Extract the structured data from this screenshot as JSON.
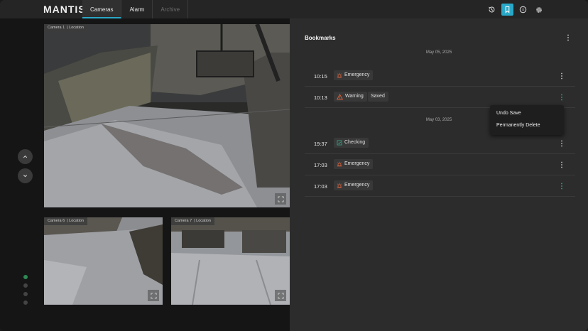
{
  "app": {
    "logo": "MANTIS"
  },
  "tabs": [
    {
      "label": "Cameras",
      "state": "active"
    },
    {
      "label": "Alarm",
      "state": "normal"
    },
    {
      "label": "Archive",
      "state": "disabled"
    }
  ],
  "toolbar": {
    "icons": [
      "history-icon",
      "bookmark-icon",
      "info-icon",
      "settings-icon"
    ],
    "active_icon": "bookmark-icon",
    "accent_color": "#2aa8c8"
  },
  "cameras": {
    "main": {
      "label": "Camera 1",
      "sublabel": "Location"
    },
    "tile_left": {
      "label": "Camera 6",
      "sublabel": "Location"
    },
    "tile_right": {
      "label": "Camera 7",
      "sublabel": "Location"
    }
  },
  "pager": {
    "pages": 4,
    "active_page": 1,
    "active_color": "#2e8a55"
  },
  "bookmarks": {
    "title": "Bookmarks",
    "groups": [
      {
        "date": "May 05, 2025",
        "items": [
          {
            "time": "10:15",
            "tag": "Emergency",
            "tag_icon": "emergency-icon",
            "tag_color": "#e0643c",
            "extra": ""
          },
          {
            "time": "10:13",
            "tag": "Warning",
            "tag_icon": "warning-icon",
            "tag_color": "#e0643c",
            "extra": "Saved"
          }
        ]
      },
      {
        "date": "May 03, 2025",
        "items": [
          {
            "time": "19:37",
            "tag": "Checking",
            "tag_icon": "checking-icon",
            "tag_color": "#3aa88a",
            "extra": ""
          },
          {
            "time": "17:03",
            "tag": "Emergency",
            "tag_icon": "emergency-icon",
            "tag_color": "#e0643c",
            "extra": ""
          },
          {
            "time": "17:03",
            "tag": "Emergency",
            "tag_icon": "emergency-icon",
            "tag_color": "#e0643c",
            "extra": ""
          }
        ]
      }
    ]
  },
  "context_menu": {
    "items": [
      "Undo Save",
      "Permanently Delete"
    ]
  }
}
